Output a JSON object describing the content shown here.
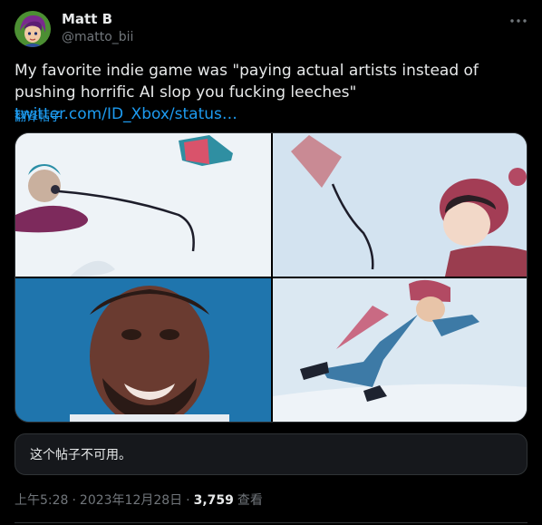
{
  "author": {
    "name": "Matt B",
    "handle": "@matto_bii"
  },
  "tweet": {
    "text": "My favorite indie game was \"paying actual artists instead of pushing horrific AI slop you fucking leeches\"",
    "link": "twitter.com/ID_Xbox/status…",
    "translate_label": "翻译帖子"
  },
  "media": {
    "images": [
      {
        "icon": "image-snow-character-1"
      },
      {
        "icon": "image-snow-character-2"
      },
      {
        "icon": "image-smiling-man"
      },
      {
        "icon": "image-skier-falling"
      }
    ]
  },
  "quoted": {
    "unavailable_text": "这个帖子不可用。"
  },
  "meta": {
    "time": "上午5:28",
    "sep1": "·",
    "date": "2023年12月28日",
    "sep2": "·",
    "views_count": "3,759",
    "views_label": "查看"
  },
  "colors": {
    "background": "#000000",
    "text": "#e7e9ea",
    "secondary": "#71767b",
    "link": "#1d9bf0",
    "border": "#2f3336"
  }
}
